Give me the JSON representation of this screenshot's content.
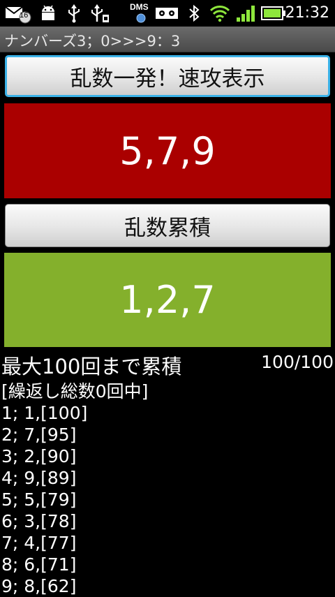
{
  "status_bar": {
    "notification_count": "16",
    "dms_label": "DMS",
    "time": "21:32",
    "icons": [
      "message-icon",
      "android-icon",
      "usb-icon",
      "usb-debug-icon",
      "dms-icon",
      "voicemail-icon",
      "bluetooth-icon",
      "wifi-icon",
      "signal-icon",
      "battery-icon"
    ]
  },
  "app": {
    "title": "ナンバーズ3；0>>>9：3"
  },
  "quick": {
    "button_label": "乱数一発！速攻表示",
    "result": "5,7,9",
    "result_color": "#aa0000"
  },
  "cumulative": {
    "button_label": "乱数累積",
    "result": "1,2,7",
    "result_color": "#84b02c"
  },
  "summary": {
    "max_label": "最大100回まで累積",
    "counter": "100/100"
  },
  "list": {
    "header": "[繰返し総数0回中]",
    "rows": [
      "1; 1,[100]",
      "2; 7,[95]",
      "3; 2,[90]",
      "4; 9,[89]",
      "5; 5,[79]",
      "6; 3,[78]",
      "7; 4,[77]",
      "8; 6,[71]",
      "9; 8,[62]"
    ]
  }
}
